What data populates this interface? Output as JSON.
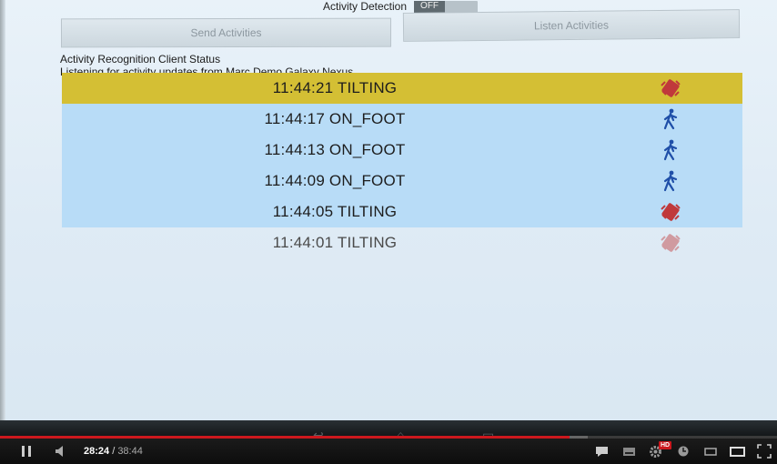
{
  "screen": {
    "toggle": {
      "label": "Activity Detection",
      "state": "OFF"
    },
    "buttons": {
      "send": "Send Activities",
      "listen": "Listen Activities"
    },
    "status_title": "Activity Recognition Client Status",
    "status_sub": "Listening for activity updates from Marc Demo Galaxy Nexus",
    "activities": [
      {
        "text": "11:44:21 TILTING",
        "icon": "tilting-icon",
        "selected": true,
        "faded": false
      },
      {
        "text": "11:44:17 ON_FOOT",
        "icon": "walking-icon",
        "selected": false,
        "faded": false
      },
      {
        "text": "11:44:13 ON_FOOT",
        "icon": "walking-icon",
        "selected": false,
        "faded": false
      },
      {
        "text": "11:44:09 ON_FOOT",
        "icon": "walking-icon",
        "selected": false,
        "faded": false
      },
      {
        "text": "11:44:05 TILTING",
        "icon": "tilting-icon",
        "selected": false,
        "faded": false
      },
      {
        "text": "11:44:01 TILTING",
        "icon": "tilting-icon",
        "selected": false,
        "faded": true
      }
    ],
    "colors": {
      "selected_row": "#d4bf34",
      "row": "#b8dcf7",
      "walk_icon": "#1f4fa8",
      "tilt_icon": "#c0393b"
    }
  },
  "player": {
    "current_time": "28:24",
    "separator": " / ",
    "duration": "38:44",
    "played_fraction": 0.733,
    "buffered_fraction": 0.757,
    "hd_badge": "HD",
    "accent": "#cc181e"
  }
}
